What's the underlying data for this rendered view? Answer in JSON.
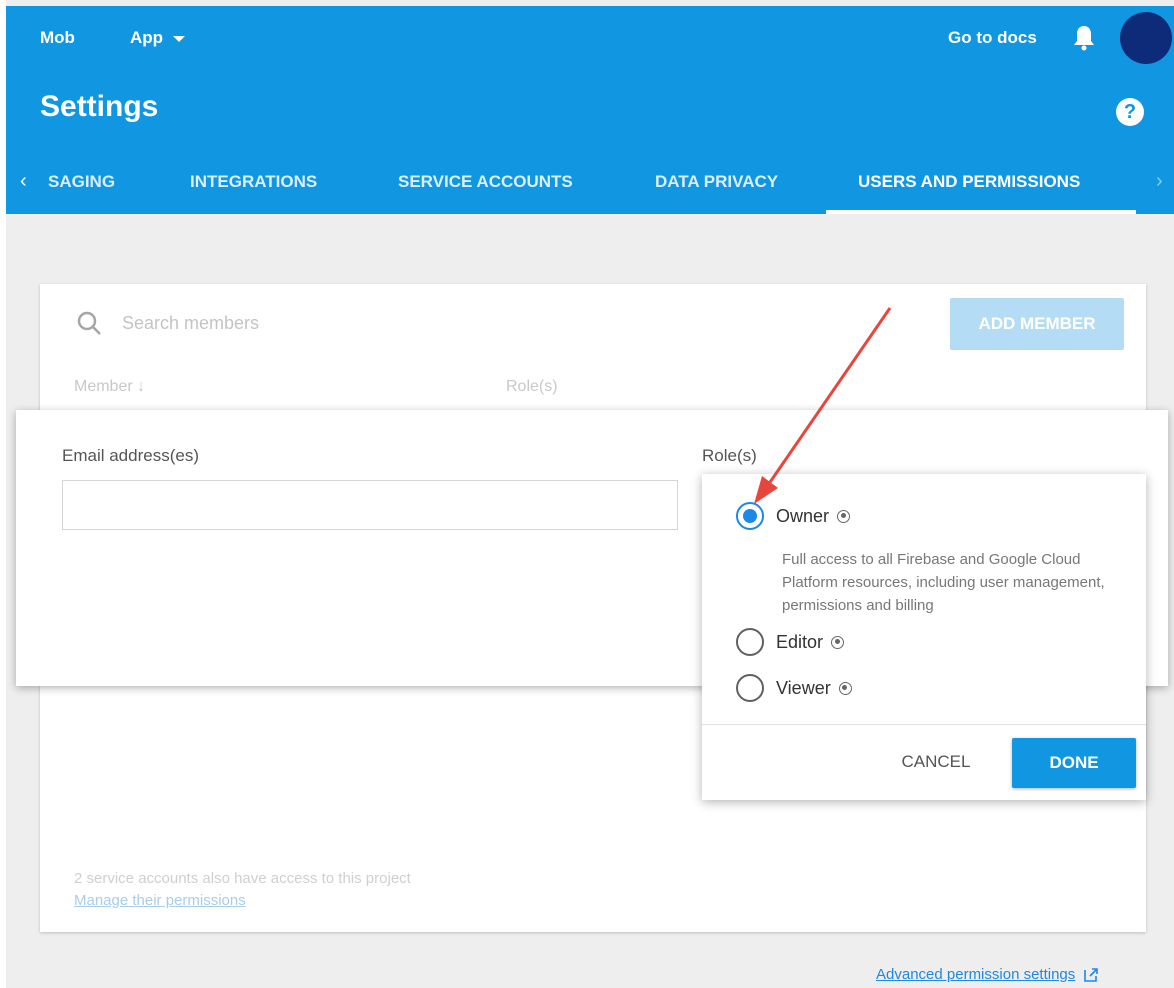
{
  "header": {
    "project": "Mob",
    "app_label": "App",
    "go_to_docs": "Go to docs",
    "title": "Settings",
    "help": "?"
  },
  "tabs": {
    "prev": "‹",
    "next": "›",
    "items": [
      {
        "label": "SAGING"
      },
      {
        "label": "INTEGRATIONS"
      },
      {
        "label": "SERVICE ACCOUNTS"
      },
      {
        "label": "DATA PRIVACY"
      },
      {
        "label": "USERS AND PERMISSIONS",
        "active": true
      }
    ]
  },
  "members": {
    "search_placeholder": "Search members",
    "add_member": "ADD MEMBER",
    "col_member": "Member ↓",
    "col_roles": "Role(s)",
    "service_note": "2 service accounts also have access to this project",
    "manage_link": "Manage their permissions"
  },
  "add_dialog": {
    "email_label": "Email address(es)",
    "email_value": "",
    "roles_label": "Role(s)"
  },
  "role_popup": {
    "options": [
      {
        "name": "Owner",
        "checked": true
      },
      {
        "name": "Editor",
        "checked": false
      },
      {
        "name": "Viewer",
        "checked": false
      }
    ],
    "owner_description": "Full access to all Firebase and Google Cloud Platform resources, including user management, permissions and billing",
    "cancel": "CANCEL",
    "done": "DONE"
  },
  "footer": {
    "advanced_link": "Advanced permission settings"
  },
  "colors": {
    "header_bg": "#1196e2",
    "accent": "#1e88e5",
    "annotation_arrow": "#e8453c"
  }
}
